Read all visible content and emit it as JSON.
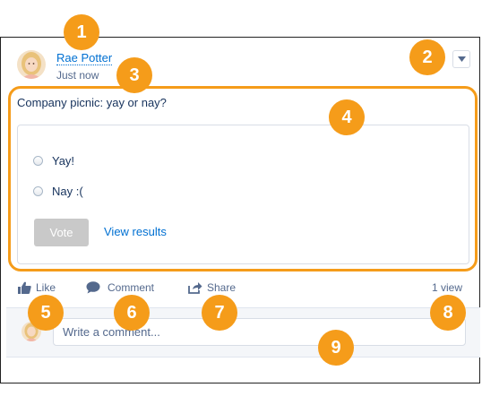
{
  "post": {
    "author": "Rae Potter",
    "timestamp": "Just now",
    "question": "Company picnic: yay or nay?",
    "poll": {
      "options": [
        "Yay!",
        "Nay :("
      ],
      "vote_label": "Vote",
      "view_results_label": "View results"
    },
    "actions": {
      "like": "Like",
      "comment": "Comment",
      "share": "Share"
    },
    "view_count": "1 view",
    "comment_placeholder": "Write a comment..."
  },
  "callouts": [
    "1",
    "2",
    "3",
    "4",
    "5",
    "6",
    "7",
    "8",
    "9"
  ],
  "colors": {
    "accent": "#f59c1a",
    "link": "#0070d2",
    "vote_disabled": "#c9c9c9"
  }
}
